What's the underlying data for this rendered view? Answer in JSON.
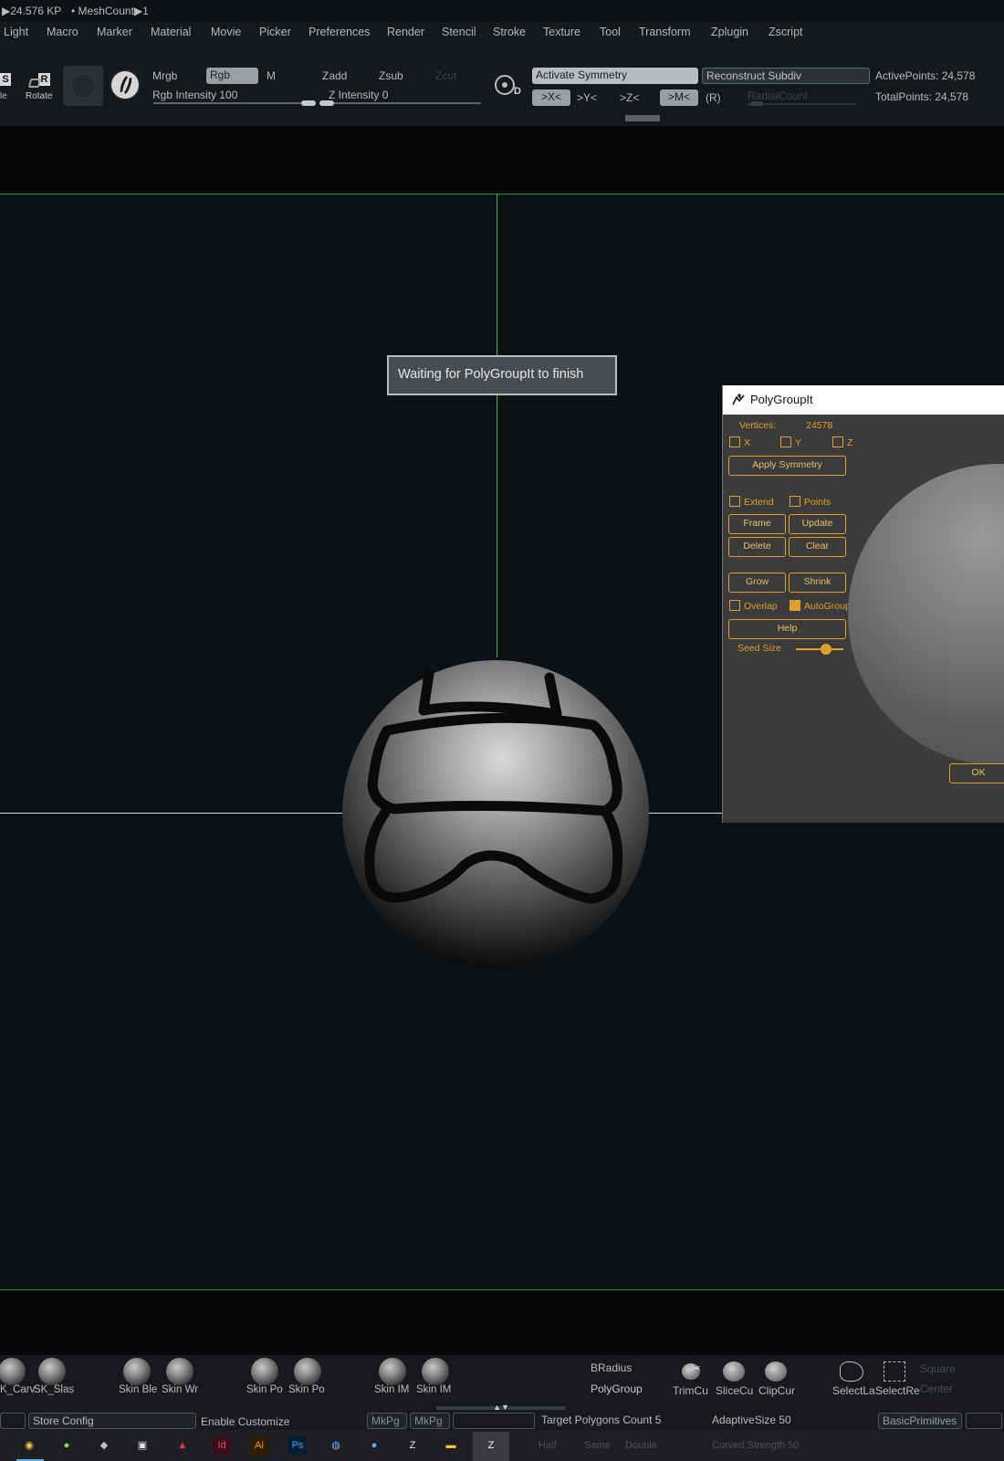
{
  "info": {
    "kp": "▶24.576 KP",
    "meshcount": "• MeshCount▶1"
  },
  "menu": [
    "Light",
    "Macro",
    "Marker",
    "Material",
    "Movie",
    "Picker",
    "Preferences",
    "Render",
    "Stencil",
    "Stroke",
    "Texture",
    "Tool",
    "Transform",
    "Zplugin",
    "Zscript"
  ],
  "toolbar": {
    "scale_label": "le",
    "rotate_label": "Rotate",
    "mrgb": "Mrgb",
    "rgb": "Rgb",
    "m": "M",
    "zadd": "Zadd",
    "zsub": "Zsub",
    "zcut": "Zcut",
    "rgb_intensity": "Rgb Intensity 100",
    "z_intensity": "Z Intensity 0",
    "activate_symmetry": "Activate Symmetry",
    "reconstruct_subdiv": "Reconstruct Subdiv",
    "x_sym": ">X<",
    "y_sym": ">Y<",
    "z_sym": ">Z<",
    "m_sym": ">M<",
    "r_sym": "(R)",
    "radial_count": "RadialCount",
    "active_points": "ActivePoints: 24,578",
    "total_points": "TotalPoints: 24,578",
    "s_key": "S",
    "r_key": "R",
    "d_key": "D"
  },
  "waiting_message": "Waiting for PolyGroupIt to finish",
  "polygroupit": {
    "title": "PolyGroupIt",
    "vertices_label": "Vertices:",
    "vertices_value": "24578",
    "x": "X",
    "y": "Y",
    "z": "Z",
    "apply_symmetry": "Apply Symmetry",
    "extend": "Extend",
    "points": "Points",
    "frame": "Frame",
    "update": "Update",
    "delete": "Delete",
    "clear": "Clear",
    "grow": "Grow",
    "shrink": "Shrink",
    "overlap": "Overlap",
    "autogroup": "AutoGroup",
    "autogroup_checked": true,
    "help": "Help",
    "seed_size": "Seed Size",
    "seed_size_level": 0.75,
    "ok": "OK"
  },
  "shelf": {
    "brushes": [
      "K_Carv",
      "SK_Slas",
      "Skin Ble",
      "Skin Wr",
      "Skin Po",
      "Skin Po",
      "Skin IM",
      "Skin IM"
    ],
    "bradius": "BRadius",
    "polygroup": "PolyGroup",
    "trimcurve": "TrimCu",
    "slicecurve": "SliceCu",
    "clipcurve": "ClipCur",
    "selectlasso": "SelectLa",
    "selectrect": "SelectRe",
    "square": "Square",
    "center": "Center"
  },
  "statusbar": {
    "store_config": "Store Config",
    "enable_customize": "Enable Customize",
    "mkpg1": "MkPg",
    "mkpg2": "MkPg",
    "target_polygons": "Target Polygons Count 5",
    "adaptive_size": "AdaptiveSize 50",
    "basic_primitives": "BasicPrimitives",
    "half": "Half",
    "same": "Same",
    "double": "Double",
    "curve_strength": "Curved Strength 50"
  },
  "colors": {
    "accent_orange": "#e0a12a",
    "guide_green": "#3bbb2e",
    "panel_gray": "#3b3b3b"
  }
}
